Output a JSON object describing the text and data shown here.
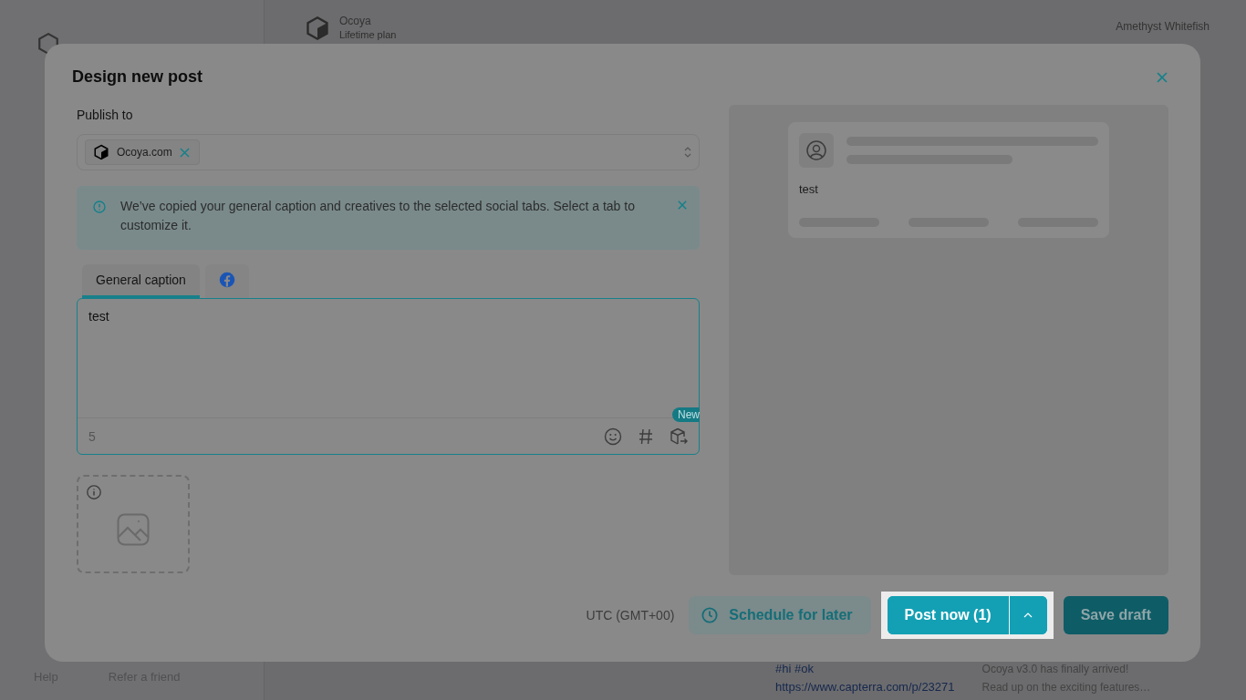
{
  "app": {
    "workspace": {
      "name": "Ocoya",
      "plan": "Lifetime plan"
    },
    "user": {
      "name": "Amethyst Whitefish"
    },
    "sidebar_footer": [
      "Help",
      "Refer a friend"
    ],
    "post_preview": {
      "hashtags": "#hi #ok",
      "link": "https://www.capterra.com/p/23271"
    },
    "news": {
      "title": "Ocoya v3.0 has finally arrived!",
      "text": "Read up on the exciting features…"
    }
  },
  "dialog": {
    "title": "Design new post",
    "publish_to": {
      "label": "Publish to",
      "accounts": [
        {
          "name": "Ocoya.com"
        }
      ]
    },
    "notice": {
      "text": "We’ve copied your general caption and creatives to the selected social tabs. Select a tab to customize it."
    },
    "tabs": [
      {
        "kind": "text",
        "label": "General caption",
        "selected": true
      },
      {
        "kind": "facebook",
        "selected": false
      }
    ],
    "caption": {
      "value": "test",
      "char_count": "5",
      "badge": "New"
    },
    "preview": {
      "caption": "test"
    },
    "footer": {
      "timezone": "UTC (GMT+00)",
      "schedule": "Schedule for later",
      "post_now": "Post now (1)",
      "save_draft": "Save draft"
    }
  }
}
